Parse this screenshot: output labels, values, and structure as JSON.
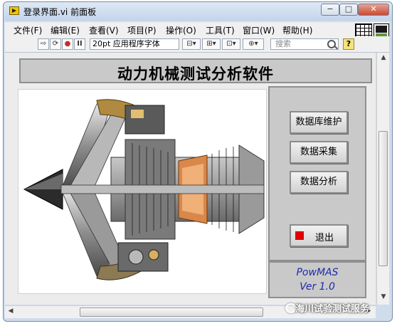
{
  "window": {
    "title": "登录界面.vi 前面板",
    "controls": {
      "minimize": "−",
      "maximize": "□",
      "close": "✕"
    }
  },
  "menubar": {
    "items": [
      "文件(F)",
      "编辑(E)",
      "查看(V)",
      "项目(P)",
      "操作(O)",
      "工具(T)",
      "窗口(W)",
      "帮助(H)"
    ]
  },
  "toolbar": {
    "run": "⇨",
    "run_continuous": "⟳",
    "abort": "●",
    "pause": "II",
    "font": "20pt 应用程序字体",
    "align": "⊟▾",
    "distribute": "⊞▾",
    "resize": "⊡▾",
    "reorder": "⊕▾",
    "search_placeholder": "搜索",
    "help": "?"
  },
  "front_panel": {
    "app_title": "动力机械测试分析软件",
    "buttons": {
      "db_maintenance": "数据库维护",
      "data_acquisition": "数据采集",
      "data_analysis": "数据分析",
      "exit": "退出"
    },
    "brand": {
      "name": "PowMAS",
      "version": "Ver 1.0"
    }
  },
  "watermark": "海川试验测试服务",
  "colors": {
    "panel_gray": "#c9c9c9",
    "brand_blue": "#1e2aa8",
    "stop_red": "#e00000"
  },
  "icons": [
    "labview-vi-icon",
    "grid-connector-icon",
    "search-icon",
    "help-icon",
    "stop-icon",
    "turbofan-engine-image",
    "wechat-icon"
  ]
}
